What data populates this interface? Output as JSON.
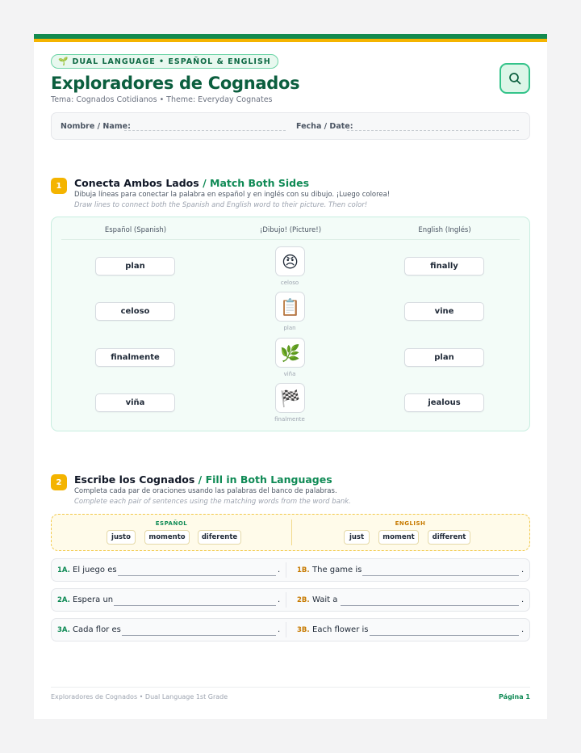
{
  "header": {
    "tag": "DUAL LANGUAGE • ESPAÑOL & ENGLISH",
    "sprout_icon": "🌱",
    "title": "Exploradores de Cognados",
    "subtitle": "Tema: Cognados Cotidianos • Theme: Everyday Cognates"
  },
  "name_row": {
    "name_label": "Nombre / Name:",
    "date_label": "Fecha / Date:"
  },
  "section1": {
    "number": "1",
    "title_es": "Conecta Ambos Lados",
    "title_sep": " / ",
    "title_en": "Match Both Sides",
    "instr_es": "Dibuja líneas para conectar la palabra en español y en inglés con su dibujo. ¡Luego colorea!",
    "instr_en": "Draw lines to connect both the Spanish and English word to their picture. Then color!",
    "col_spanish": "Español (Spanish)",
    "col_picture": "¡Dibujo! (Picture!)",
    "col_english": "English (Inglés)",
    "rows": [
      {
        "spanish": "plan",
        "picture": "😠",
        "picture_label": "celoso",
        "english": "finally"
      },
      {
        "spanish": "celoso",
        "picture": "📋",
        "picture_label": "plan",
        "english": "vine"
      },
      {
        "spanish": "finalmente",
        "picture": "🌿",
        "picture_label": "viña",
        "english": "plan"
      },
      {
        "spanish": "viña",
        "picture": "🏁",
        "picture_label": "finalmente",
        "english": "jealous"
      }
    ]
  },
  "section2": {
    "number": "2",
    "title_es": "Escribe los Cognados",
    "title_sep": " / ",
    "title_en": "Fill in Both Languages",
    "instr_es": "Completa cada par de oraciones usando las palabras del banco de palabras.",
    "instr_en": "Complete each pair of sentences using the matching words from the word bank.",
    "bank_es_label": "ESPAÑOL",
    "bank_en_label": "ENGLISH",
    "bank_es": [
      "justo",
      "momento",
      "diferente"
    ],
    "bank_en": [
      "just",
      "moment",
      "different"
    ],
    "sentences": [
      {
        "num_a": "1A.",
        "text_a": "El juego es",
        "num_b": "1B.",
        "text_b": "The game is"
      },
      {
        "num_a": "2A.",
        "text_a": "Espera un",
        "num_b": "2B.",
        "text_b": "Wait a"
      },
      {
        "num_a": "3A.",
        "text_a": "Cada flor es",
        "num_b": "3B.",
        "text_b": "Each flower is"
      }
    ],
    "period": "."
  },
  "footer": {
    "left": "Exploradores de Cognados • Dual Language 1st Grade",
    "right": "Página 1"
  },
  "colors": {
    "brand_green": "#0b5e3e",
    "accent_green": "#0f8a55",
    "accent_yellow": "#f4b400",
    "english_orange": "#c77a00"
  }
}
